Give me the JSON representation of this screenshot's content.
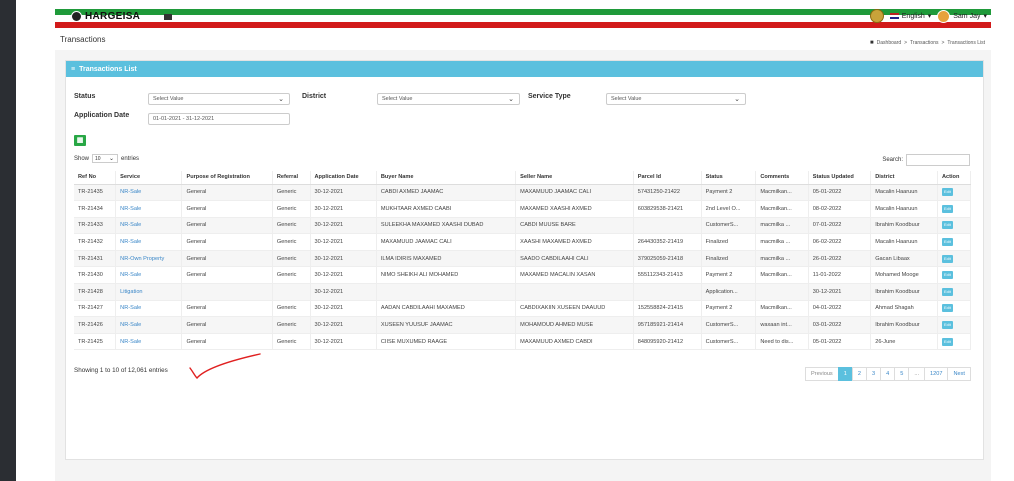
{
  "topbar": {
    "logo_text": "HARGEISA",
    "language": "English",
    "user": "Sam Jay"
  },
  "page": {
    "title": "Transactions",
    "breadcrumb": [
      "Dashboard",
      "Transactions",
      "Transactions List"
    ]
  },
  "card": {
    "title": "Transactions List"
  },
  "filters": {
    "status_label": "Status",
    "status_placeholder": "Select Value",
    "district_label": "District",
    "district_placeholder": "Select Value",
    "service_type_label": "Service Type",
    "service_type_placeholder": "Select Value",
    "application_date_label": "Application Date",
    "application_date_value": "01-01-2021 - 31-12-2021"
  },
  "table_controls": {
    "show_label": "Show",
    "show_value": "10",
    "entries_label": "entries",
    "search_label": "Search:"
  },
  "table": {
    "columns": [
      "Ref No",
      "Service",
      "Purpose of Registration",
      "Referral",
      "Application Date",
      "Buyer Name",
      "Seller Name",
      "Parcel Id",
      "Status",
      "Comments",
      "Status Updated",
      "District",
      "Action"
    ],
    "action_label": "Edit",
    "rows": [
      [
        "TR-21435",
        "NR-Sale",
        "General",
        "Generic",
        "30-12-2021",
        "CABDI AXMED JAAMAC",
        "MAXAMUUD JAAMAC CALI",
        "57431250-21422",
        "Payment 2",
        "Macmilkan...",
        "05-01-2022",
        "Macalin Haaruun"
      ],
      [
        "TR-21434",
        "NR-Sale",
        "General",
        "Generic",
        "30-12-2021",
        "MUKHTAAR AXMED CAABI",
        "MAXAMED XAASHI AXMED",
        "603829538-21421",
        "2nd Level O...",
        "Macmilkan...",
        "08-02-2022",
        "Macalin Haaruun"
      ],
      [
        "TR-21433",
        "NR-Sale",
        "General",
        "Generic",
        "30-12-2021",
        "SULEEKHA MAXAMED XAASHI DUBAD",
        "CABDI MUUSE BARE",
        "",
        "CustomerS...",
        "macmilka ...",
        "07-01-2022",
        "Ibrahim Koodbuur"
      ],
      [
        "TR-21432",
        "NR-Sale",
        "General",
        "Generic",
        "30-12-2021",
        "MAXAMUUD JAAMAC CALI",
        "XAASHI MAXAMED AXMED",
        "264430352-21419",
        "Finalized",
        "macmilka ...",
        "06-02-2022",
        "Macalin Haaruun"
      ],
      [
        "TR-21431",
        "NR-Own Property",
        "General",
        "Generic",
        "30-12-2021",
        "ILMA IDIRIS MAXAMED",
        "SAADO CABDILAAHI CALI",
        "379025059-21418",
        "Finalized",
        "macmilka ...",
        "26-01-2022",
        "Gacan Libaax"
      ],
      [
        "TR-21430",
        "NR-Sale",
        "General",
        "Generic",
        "30-12-2021",
        "NIMO SHEIKH ALI MOHAMED",
        "MAXAMED MACALIN XASAN",
        "555112343-21413",
        "Payment 2",
        "Macmilkan...",
        "11-01-2022",
        "Mohamed Mooge"
      ],
      [
        "TR-21428",
        "Litigation",
        "",
        "",
        "30-12-2021",
        "",
        "",
        "",
        "Application...",
        "",
        "30-12-2021",
        "Ibrahim Koodbuur"
      ],
      [
        "TR-21427",
        "NR-Sale",
        "General",
        "Generic",
        "30-12-2021",
        "AADAN CABDILAAHI MAXAMED",
        "CABDIXAKIIN XUSEEN DAAUUD",
        "152558824-21415",
        "Payment 2",
        "Macmilkan...",
        "04-01-2022",
        "Ahmad Shagah"
      ],
      [
        "TR-21426",
        "NR-Sale",
        "General",
        "Generic",
        "30-12-2021",
        "XUSEEN YUUSUF JAAMAC",
        "MOHAMOUD AHMED MUSE",
        "957185921-21414",
        "CustomerS...",
        "waxaan int...",
        "03-01-2022",
        "Ibrahim Koodbuur"
      ],
      [
        "TR-21425",
        "NR-Sale",
        "General",
        "Generic",
        "30-12-2021",
        "CIISE MUXUMED RAAGE",
        "MAXAMUUD AXMED CABDI",
        "848095920-21412",
        "CustomerS...",
        "Need to dis...",
        "05-01-2022",
        "26-June"
      ]
    ]
  },
  "footer": {
    "info": "Showing 1 to 10 of 12,061 entries",
    "pagination": [
      "Previous",
      "1",
      "2",
      "3",
      "4",
      "5",
      "...",
      "1207",
      "Next"
    ]
  },
  "colors": {
    "header_blue": "#5bc0de",
    "flag_green": "#1f9a3a",
    "flag_red": "#d21a1a",
    "annotation_red": "#e02020"
  }
}
